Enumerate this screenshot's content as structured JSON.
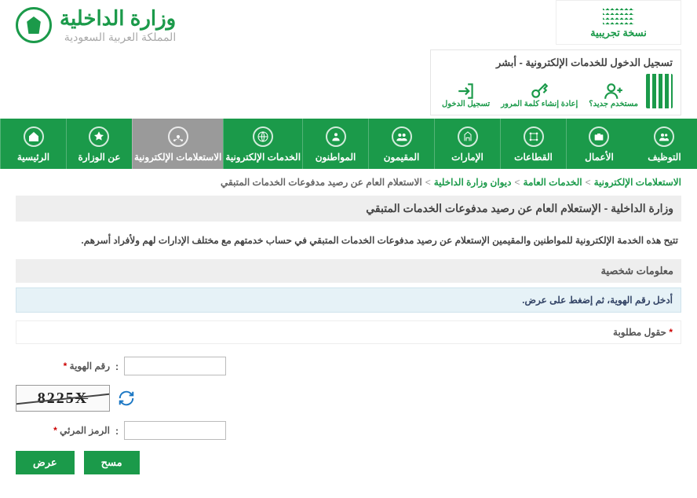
{
  "banner": {
    "line2": "نسخة تجريبية"
  },
  "absher": {
    "title": "تسجيل الدخول للخدمات الإلكترونية - أبشر",
    "links": [
      {
        "label": "مستخدم جديد؟"
      },
      {
        "label": "إعادة إنشاء كلمة المرور"
      },
      {
        "label": "تسجيل الدخول"
      }
    ]
  },
  "brand": {
    "line1": "وزارة الداخلية",
    "line2": "المملكة العربية السعودية"
  },
  "nav": [
    {
      "label": "الرئيسية"
    },
    {
      "label": "عن الوزارة"
    },
    {
      "label": "الاستعلامات الإلكترونية",
      "active": true
    },
    {
      "label": "الخدمات الإلكترونية"
    },
    {
      "label": "المواطنون"
    },
    {
      "label": "المقيمون"
    },
    {
      "label": "الإمارات"
    },
    {
      "label": "القطاعات"
    },
    {
      "label": "الأعمال"
    },
    {
      "label": "التوظيف"
    }
  ],
  "crumbs": {
    "items": [
      "الاستعلامات الإلكترونية",
      "الخدمات العامة",
      "ديوان وزارة الداخلية"
    ],
    "last": "الاستعلام العام عن رصيد مدفوعات الخدمات المتبقي"
  },
  "page_title": "وزارة الداخلية - الإستعلام العام عن رصيد مدفوعات الخدمات المتبقي",
  "description": "تتيح هذه الخدمة الإلكترونية للمواطنين والمقيمين الإستعلام عن رصيد مدفوعات الخدمات المتبقي في حساب خدمتهم مع مختلف الإدارات لهم ولأفراد أسرهم.",
  "section_head": "معلومات شخصية",
  "hint": "أدخل رقم الهوية، ثم إضغط على عرض.",
  "required_label": "حقول مطلوبة",
  "fields": {
    "id_label": "رقم الهوية",
    "captcha_label": "الرمز المرئي",
    "captcha_value": "8225"
  },
  "buttons": {
    "submit": "عرض",
    "clear": "مسح"
  }
}
